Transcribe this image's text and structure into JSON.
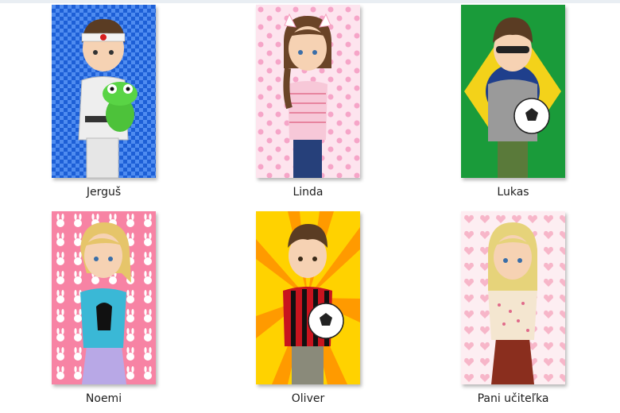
{
  "files": [
    {
      "name": "Jerguš",
      "background": "blue-checker",
      "bg_colors": [
        "#1d5fd6",
        "#4f8cf0"
      ]
    },
    {
      "name": "Linda",
      "background": "pink-flower-pattern",
      "bg_colors": [
        "#fde4ee",
        "#f6a5c8"
      ]
    },
    {
      "name": "Lukas",
      "background": "brazil-flag",
      "bg_colors": [
        "#1a9b3a",
        "#f3d21a",
        "#1f3f8c"
      ]
    },
    {
      "name": "Noemi",
      "background": "pink-bunny-pattern",
      "bg_colors": [
        "#f783a4",
        "#ffffff"
      ]
    },
    {
      "name": "Oliver",
      "background": "yellow-sunburst",
      "bg_colors": [
        "#ffd200",
        "#ff9a00"
      ]
    },
    {
      "name": "Pani učiteľka",
      "background": "pink-heart-pattern",
      "bg_colors": [
        "#fdeef2",
        "#f7b6c9"
      ]
    }
  ]
}
